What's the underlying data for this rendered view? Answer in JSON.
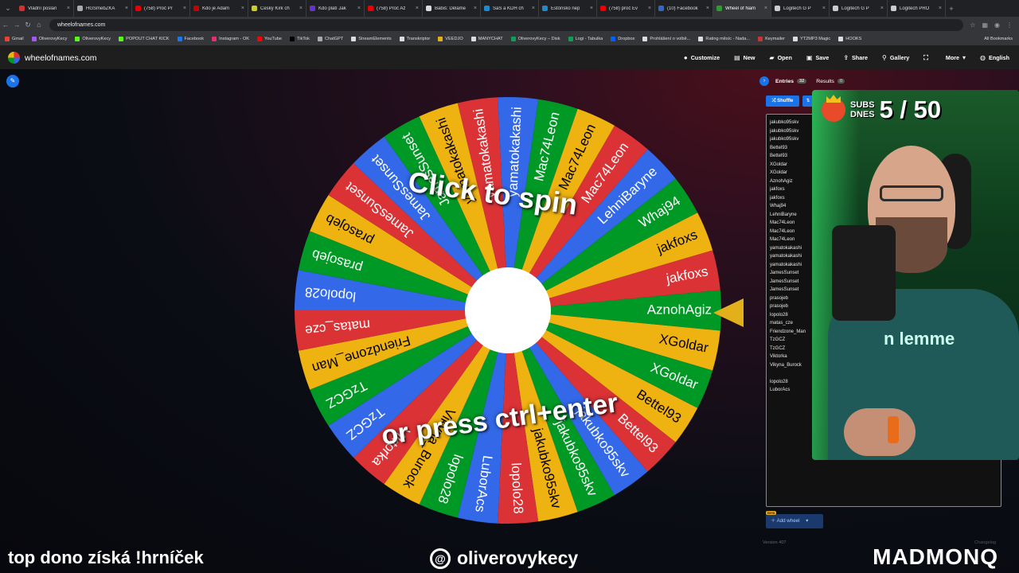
{
  "browser": {
    "tabs": [
      {
        "title": "Vládní poslan",
        "color": "#c33"
      },
      {
        "title": "HGSmebZKA",
        "color": "#aaa"
      },
      {
        "title": "(758) Proč Pr",
        "color": "#e00"
      },
      {
        "title": "Kdo je Adam",
        "color": "#c00"
      },
      {
        "title": "Český Kirk ch",
        "color": "#cc3"
      },
      {
        "title": "Kdo platí Jak",
        "color": "#63c"
      },
      {
        "title": "(758) Proč Až",
        "color": "#e00"
      },
      {
        "title": "Babiš: Děláme",
        "color": "#ddd"
      },
      {
        "title": "SaS a KDH ch",
        "color": "#28c"
      },
      {
        "title": "Estónsko nep",
        "color": "#28c"
      },
      {
        "title": "(758) proč Ev",
        "color": "#e00"
      },
      {
        "title": "(10) Facebook",
        "color": "#36c"
      },
      {
        "title": "Wheel of Nam",
        "color": "#393",
        "active": true
      },
      {
        "title": "Logitech G P",
        "color": "#ccc"
      },
      {
        "title": "Logitech G P",
        "color": "#ccc"
      },
      {
        "title": "Logitech PRO",
        "color": "#ccc"
      }
    ],
    "url": "wheelofnames.com",
    "bookmarks": [
      {
        "label": "Gmail",
        "color": "#ea4335"
      },
      {
        "label": "OliverovyKecy",
        "color": "#a855f7"
      },
      {
        "label": "OliverovyKecy",
        "color": "#53fc18"
      },
      {
        "label": "POPOUT CHAT KICK",
        "color": "#53fc18"
      },
      {
        "label": "Facebook",
        "color": "#1877f2"
      },
      {
        "label": "Instagram - OK",
        "color": "#e1306c"
      },
      {
        "label": "YouTube",
        "color": "#ff0000"
      },
      {
        "label": "TikTok",
        "color": "#000"
      },
      {
        "label": "ChatGPT",
        "color": "#aaa"
      },
      {
        "label": "StreamElements",
        "color": "#ddd"
      },
      {
        "label": "Transkriptor",
        "color": "#ddd"
      },
      {
        "label": "VEEDJO",
        "color": "#e2b01a"
      },
      {
        "label": "MANYCHAT",
        "color": "#ddd"
      },
      {
        "label": "OliverovyKecy – Disk",
        "color": "#0f9d58"
      },
      {
        "label": "Logi - Tabulka",
        "color": "#0f9d58"
      },
      {
        "label": "Dropbox",
        "color": "#0061ff"
      },
      {
        "label": "Prohlášení o volbě...",
        "color": "#ddd"
      },
      {
        "label": "Rating měsíc - Nada...",
        "color": "#ddd"
      },
      {
        "label": "Keymailer",
        "color": "#c33"
      },
      {
        "label": "YT2MP3 Magic",
        "color": "#ddd"
      },
      {
        "label": "HOOKS",
        "color": "#ddd"
      }
    ],
    "all_bookmarks": "All Bookmarks"
  },
  "app": {
    "site_name": "wheelofnames.com",
    "menu": [
      {
        "label": "Customize",
        "icon": "palette-icon",
        "glyph": "●"
      },
      {
        "label": "New",
        "icon": "new-file-icon",
        "glyph": "▤"
      },
      {
        "label": "Open",
        "icon": "folder-icon",
        "glyph": "▰"
      },
      {
        "label": "Save",
        "icon": "save-icon",
        "glyph": "▣"
      },
      {
        "label": "Share",
        "icon": "share-icon",
        "glyph": "⇪"
      },
      {
        "label": "Gallery",
        "icon": "search-icon",
        "glyph": "⚲"
      },
      {
        "label": "",
        "icon": "fullscreen-icon",
        "glyph": "⛶"
      },
      {
        "label": "More",
        "icon": "more-chevron-icon",
        "glyph": "▾"
      },
      {
        "label": "English",
        "icon": "globe-icon",
        "glyph": "◍"
      }
    ]
  },
  "wheel": {
    "colors": [
      "#db3236",
      "#3369e8",
      "#009925",
      "#eeb211"
    ],
    "pointer_color": "#e2b01a",
    "cta_line1": "Click to spin",
    "cta_line2": "or press ctrl+enter",
    "segments": [
      "AznohAgiz",
      "XGoldar",
      "XGoldar",
      "Bettel93",
      "Bettel93",
      "jakubko95skv",
      "jakubko95skv",
      "jakubko95skv",
      "lopolo28",
      "LuborAcs",
      "lopolo28",
      "Vikyna_Burock",
      "Viktorka",
      "TzGCZ",
      "TzGCZ",
      "Friendzone_Man",
      "matas_cze",
      "lopolo28",
      "prasojeb",
      "prasojeb",
      "JamesSunset",
      "JamesSunset",
      "JamesSunset",
      "yamatokakashi",
      "yamatokakashi",
      "yamatokakashi",
      "Mac74Leon",
      "Mac74Leon",
      "Mac74Leon",
      "LehniBaryne",
      "Whaj94",
      "jakfoxs",
      "jakfoxs"
    ]
  },
  "panel": {
    "tab_entries": "Entries",
    "entries_count": "32",
    "tab_results": "Results",
    "results_count": "0",
    "shuffle_label": "Shuffle",
    "sort_label": "Sort",
    "entries": [
      "jakubko95skv",
      "jakubko95skv",
      "jakubko95skv",
      "Bettel93",
      "Bettel93",
      "XGoldar",
      "XGoldar",
      "AznohAgiz",
      "jakfoxs",
      "jakfoxs",
      "Whaj94",
      "LehniBaryne",
      "Mac74Leon",
      "Mac74Leon",
      "Mac74Leon",
      "yamatokakashi",
      "yamatokakashi",
      "yamatokakashi",
      "JamesSunset",
      "JamesSunset",
      "JamesSunset",
      "prasojeb",
      "prasojeb",
      "lopolo28",
      "matas_cze",
      "Friendzone_Man",
      "TzGCZ",
      "TzGCZ",
      "Viktorka",
      "Vikyna_Burock",
      "",
      "lopolo28",
      "LuborAcs"
    ],
    "beta_label": "Beta",
    "add_wheel_label": "Add wheel",
    "version": "Version 407",
    "changelog": "Changelog"
  },
  "stream": {
    "subs_label_1": "SUBS",
    "subs_label_2": "DNES",
    "subs_count": "5 / 50",
    "shirt_text": "n lemme",
    "bottom_left": "top dono získá !hrníček",
    "social_handle": "oliverovykecy",
    "brand": "MADMONQ"
  }
}
